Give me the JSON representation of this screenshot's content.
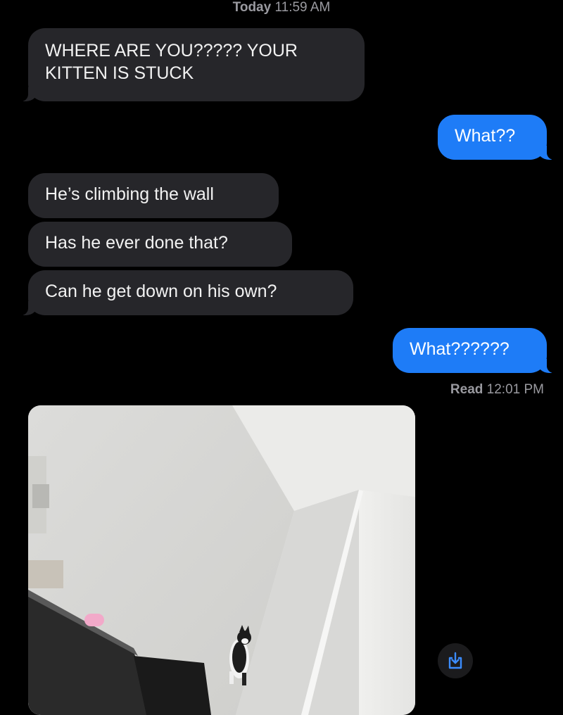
{
  "header": {
    "day": "Today",
    "time": "11:59 AM"
  },
  "messages": [
    {
      "dir": "incoming",
      "lines": [
        "WHERE ARE YOU????? YOUR",
        "KITTEN IS STUCK"
      ]
    },
    {
      "dir": "outgoing",
      "text": "What??"
    },
    {
      "dir": "incoming",
      "text": "He’s climbing the wall"
    },
    {
      "dir": "incoming",
      "text": "Has he ever done that?"
    },
    {
      "dir": "incoming",
      "text": "Can he get down on his own?"
    },
    {
      "dir": "outgoing",
      "text": "What??????"
    }
  ],
  "receipt": {
    "label": "Read",
    "time": "12:01 PM"
  },
  "attachment": {
    "type": "photo",
    "subject": "kitten-on-wall"
  },
  "icons": {
    "save": "download-to-box-icon"
  },
  "colors": {
    "background": "#000000",
    "incoming_bubble": "#26262a",
    "outgoing_bubble": "#1e7cf7",
    "meta_text": "#9a9aa0"
  }
}
